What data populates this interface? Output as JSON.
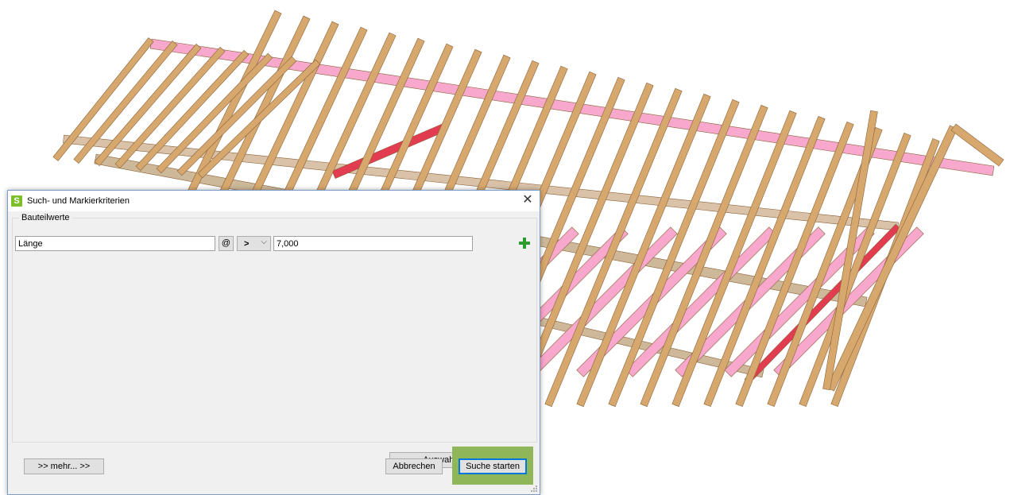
{
  "dialog": {
    "title": "Such- und Markierkriterien",
    "close_glyph": "✕",
    "group_title": "Bauteilwerte",
    "criteria": {
      "attribute_value": "Länge",
      "at_label": "@",
      "operator_value": ">",
      "value": "7,000"
    },
    "buttons": {
      "invert_label": "Auswahl umkehren",
      "more_label": ">> mehr... >>",
      "cancel_label": "Abbrechen",
      "search_label": "Suche starten"
    }
  },
  "icons": {
    "app": "app-logo-icon",
    "add": "plus-icon",
    "dropdown": "chevron-down-icon",
    "close": "close-icon"
  },
  "colors": {
    "timber": "#d7a86e",
    "highlight_pink": "#f7a8cc",
    "highlight_red": "#e23c50",
    "accent_green": "#8fb75a",
    "focus_blue": "#0078d7"
  }
}
